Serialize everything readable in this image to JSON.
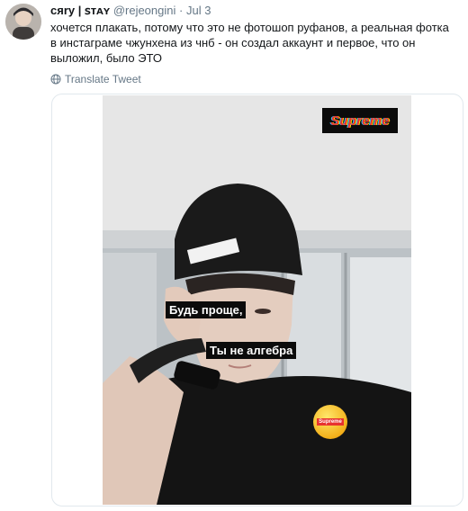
{
  "tweet": {
    "display_name": "cяry | ꜱᴛᴀʏ",
    "handle": "@rejeongini",
    "separator": "·",
    "date": "Jul 3",
    "text": "хочется плакать, потому что это не фотошоп руфанов, а реальная фотка в инстаграме чжунхена из чнб - он создал аккаунт и первое, что он выложил, было ЭТО",
    "translate_label": "Translate Tweet"
  },
  "photo": {
    "logo_text": "Supreme",
    "caption_line1": "Будь проще,",
    "caption_line2": "Ты не алгебра",
    "sticker_text": "Supreme"
  },
  "colors": {
    "text_primary": "#14171a",
    "text_secondary": "#657786",
    "border": "#e1e8ed",
    "supreme_red": "#e8322f"
  }
}
